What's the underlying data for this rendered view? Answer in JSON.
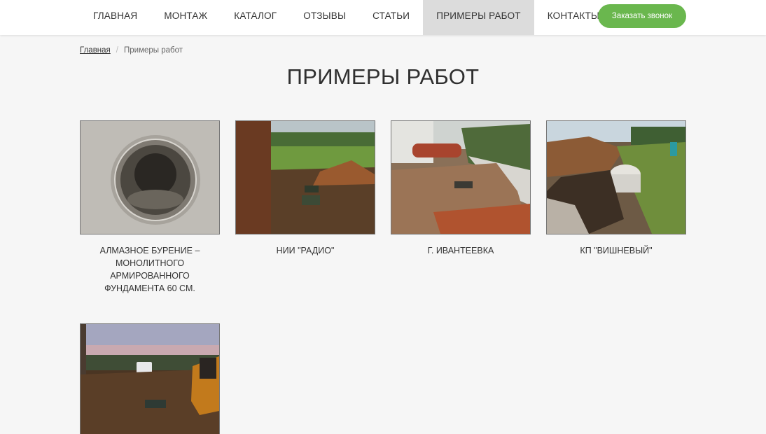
{
  "nav": {
    "items": [
      {
        "label": "ГЛАВНАЯ"
      },
      {
        "label": "МОНТАЖ"
      },
      {
        "label": "КАТАЛОГ"
      },
      {
        "label": "ОТЗЫВЫ"
      },
      {
        "label": "СТАТЬИ"
      },
      {
        "label": "ПРИМЕРЫ РАБОТ"
      },
      {
        "label": "КОНТАКТЫ"
      }
    ],
    "active_index": 5,
    "call_button": "Заказать звонок"
  },
  "breadcrumb": {
    "home": "Главная",
    "separator": "/",
    "current": "Примеры работ"
  },
  "page_title": "ПРИМЕРЫ РАБОТ",
  "works": [
    {
      "caption": "АЛМАЗНОЕ БУРЕНИЕ – МОНОЛИТНОГО АРМИРОВАННОГО ФУНДАМЕНТА 60 СМ."
    },
    {
      "caption": "НИИ \"РАДИО\""
    },
    {
      "caption": "Г. ИВАНТЕЕВКА"
    },
    {
      "caption": "КП \"ВИШНЕВЫЙ\""
    },
    {
      "caption": ""
    }
  ],
  "colors": {
    "accent_green": "#6ab74e",
    "active_nav_bg": "#dcdcdc",
    "page_bg": "#f6f6f6"
  }
}
